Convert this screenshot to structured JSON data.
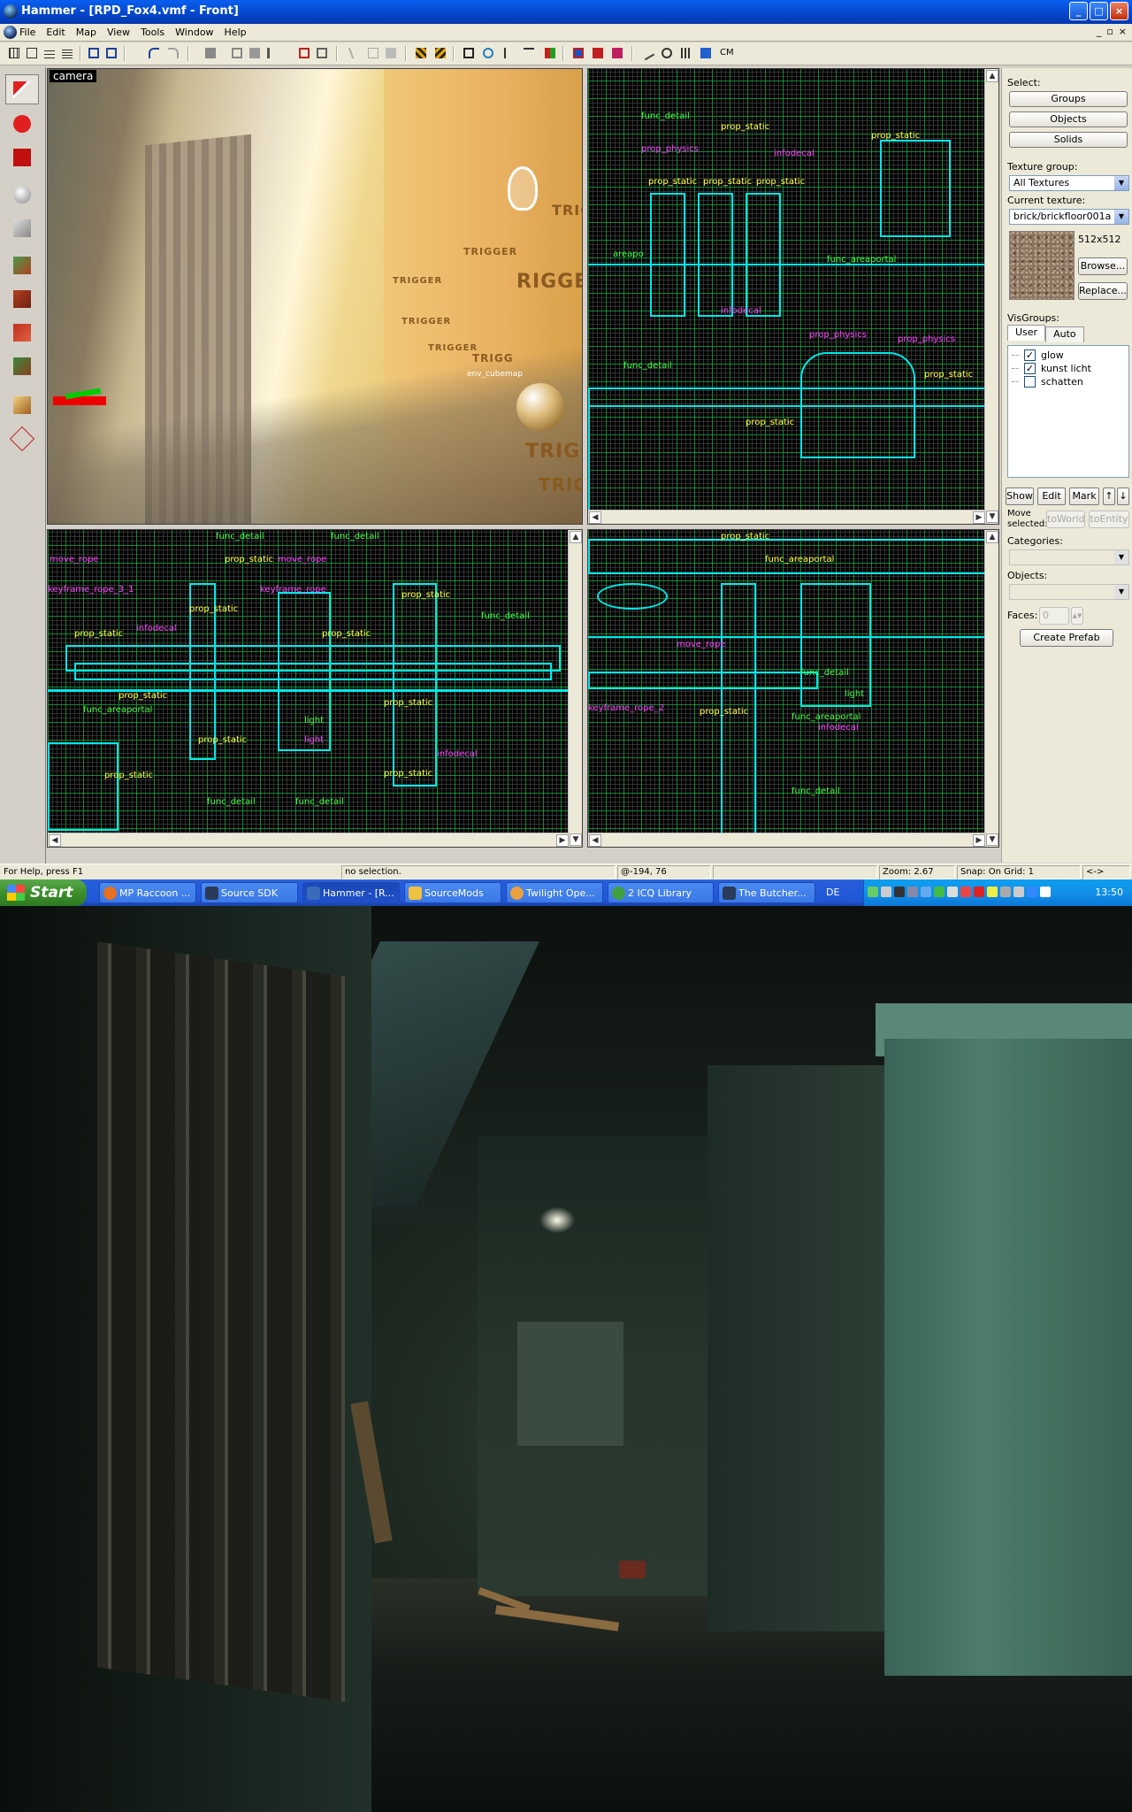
{
  "window": {
    "title": "Hammer - [RPD_Fox4.vmf - Front]",
    "controls": [
      "_",
      "□",
      "×"
    ]
  },
  "menubar": {
    "items": [
      "File",
      "Edit",
      "Map",
      "View",
      "Tools",
      "Window",
      "Help"
    ],
    "mdi_controls": [
      "_",
      "▫",
      "×"
    ]
  },
  "toolbar": {
    "cm_label": "CM"
  },
  "viewports": {
    "camera": {
      "label": "camera",
      "trigger_texts": [
        "TRIGGER",
        "RIGGER",
        "TRIGGER",
        "TRIGGER",
        "TRIGGE",
        "TRIGGEI",
        "TRIG",
        "TRIGG",
        "TRIGGER"
      ],
      "entity_label": "env_cubemap"
    },
    "front": {
      "labels": [
        "prop_static",
        "prop_static",
        "prop_static",
        "prop_static",
        "prop_physics",
        "infodecal",
        "func_areaportal",
        "prop_physics",
        "prop_static",
        "infodecal",
        "prop_static",
        "areapo",
        "func_detail",
        "prop_physics",
        "prop_static",
        "func_detail"
      ]
    },
    "top": {
      "labels": [
        "func_detail",
        "func_detail",
        "move_rope",
        "move_rope",
        "keyframe_rope",
        "prop_static",
        "prop_static",
        "prop_static",
        "prop_static",
        "infodecal",
        "prop_static",
        "prop_static",
        "prop_static",
        "prop_static",
        "light",
        "infodecal",
        "func_detail",
        "func_detail",
        "func_areaportal",
        "prop_static",
        "func_detail",
        "light",
        "prop_static",
        "keyframe_rope_3_1"
      ]
    },
    "side": {
      "labels": [
        "prop_static",
        "func_areaportal",
        "move_rope",
        "keyframe_rope_2",
        "prop_static",
        "func_detail",
        "light",
        "func_areaportal",
        "infodecal",
        "func_detail"
      ]
    }
  },
  "sidepanel": {
    "select_label": "Select:",
    "select_buttons": [
      "Groups",
      "Objects",
      "Solids"
    ],
    "texture_group_label": "Texture group:",
    "texture_group_value": "All Textures",
    "current_texture_label": "Current texture:",
    "current_texture_value": "brick/brickfloor001a",
    "texture_size": "512x512",
    "browse_label": "Browse...",
    "replace_label": "Replace...",
    "visgroups_label": "VisGroups:",
    "vis_tabs": [
      "User",
      "Auto"
    ],
    "visgroups": [
      {
        "name": "glow",
        "checked": "✓"
      },
      {
        "name": "kunst licht",
        "checked": "✓"
      },
      {
        "name": "schatten",
        "checked": ""
      }
    ],
    "vis_buttons": [
      "Show",
      "Edit",
      "Mark",
      "↑",
      "↓"
    ],
    "move_selected_label": "Move selected:",
    "to_world_label": "toWorld",
    "to_entity_label": "toEntity",
    "categories_label": "Categories:",
    "objects_label": "Objects:",
    "faces_label": "Faces:",
    "faces_value": "0",
    "create_prefab_label": "Create Prefab"
  },
  "statusbar": {
    "help": "For Help, press F1",
    "selection": "no selection.",
    "coords": "@-194, 76",
    "zoom": "Zoom: 2.67",
    "snap": "Snap: On Grid: 1",
    "extra": "<->"
  },
  "taskbar": {
    "start_label": "Start",
    "tasks": [
      {
        "label": "MP Raccoon ...",
        "icon_color": "#e87020"
      },
      {
        "label": "Source SDK",
        "icon_color": "#2a3a5a"
      },
      {
        "label": "Hammer - [R...",
        "icon_color": "#3a6ab8"
      },
      {
        "label": "SourceMods",
        "icon_color": "#f0c040"
      },
      {
        "label": "Twilight Ope...",
        "icon_color": "#e8a040"
      },
      {
        "label": "2 ICQ Library",
        "icon_color": "#40a040"
      },
      {
        "label": "The Butcher...",
        "icon_color": "#2a3a5a"
      }
    ],
    "language": "DE",
    "clock": "13:50"
  }
}
